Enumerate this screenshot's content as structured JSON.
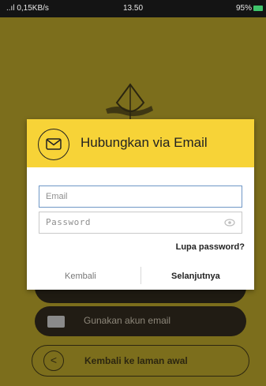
{
  "status_bar": {
    "left": "..ıl 0,15KB/s",
    "time": "13.50",
    "battery": "95%"
  },
  "background": {
    "email_account_button": "Gunakan akun email",
    "back_home_button": "Kembali ke laman awal"
  },
  "dialog": {
    "title": "Hubungkan via Email",
    "email_placeholder": "Email",
    "password_placeholder": "Password",
    "forgot_password": "Lupa password?",
    "back_button": "Kembali",
    "next_button": "Selanjutnya"
  },
  "colors": {
    "header": "#f7d337",
    "dimmed_background": "#7c6e1c",
    "email_field_border": "#6f97c6"
  }
}
